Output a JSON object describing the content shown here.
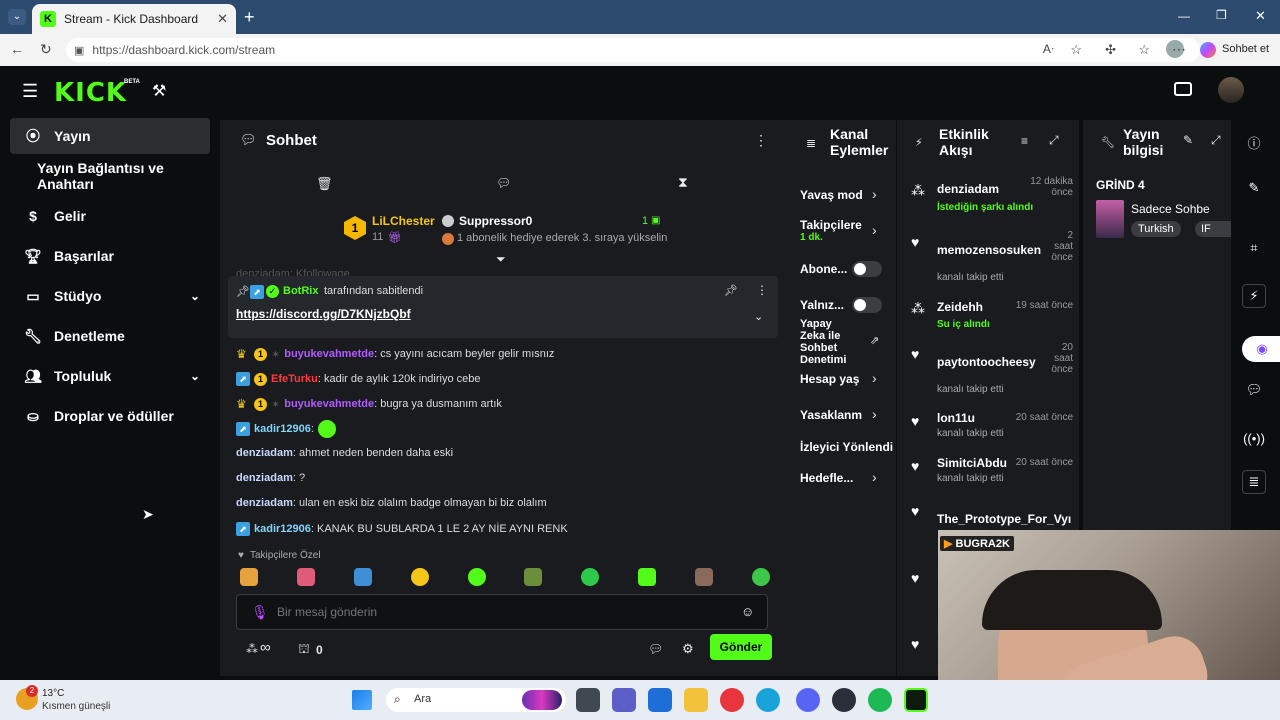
{
  "browser": {
    "tab_title": "Stream - Kick Dashboard",
    "url": "https://dashboard.kick.com/stream",
    "chat_btn": "Sohbet et"
  },
  "app": {
    "logo": "KICK",
    "beta": "BETA"
  },
  "sidebar": {
    "items": [
      {
        "label": "Yayın",
        "icon": "broadcast-icon"
      },
      {
        "label": "Yayın Bağlantısı ve Anahtarı",
        "icon": ""
      },
      {
        "label": "Gelir",
        "icon": "dollar-icon"
      },
      {
        "label": "Başarılar",
        "icon": "trophy-icon"
      },
      {
        "label": "Stüdyo",
        "icon": "studio-icon"
      },
      {
        "label": "Denetleme",
        "icon": "wrench-icon"
      },
      {
        "label": "Topluluk",
        "icon": "community-icon"
      },
      {
        "label": "Droplar ve ödüller",
        "icon": "drops-icon"
      }
    ]
  },
  "chat": {
    "title": "Sohbet",
    "gifter_top": {
      "name": "LiLChester",
      "count": "11",
      "rank": "1"
    },
    "gifter_second": {
      "name": "Suppressor0",
      "note": "1 abonelik hediye ederek 3. sıraya yükselin",
      "rank_count": "1"
    },
    "faded_line": "denziadam: Kfollowage",
    "pinned": {
      "by_name": "BotRix",
      "by_text": "tarafından sabitlendi",
      "link": "https://discord.gg/D7KNjzbQbf"
    },
    "messages": [
      {
        "user": "buyukevahmetde",
        "color": "#b15cff",
        "text": ": cs yayını acıcam beyler gelir mısnız"
      },
      {
        "user": "EfeTurku",
        "color": "#ff3b3b",
        "text": ": kadir de aylık 120k indiriyo cebe"
      },
      {
        "user": "buyukevahmetde",
        "color": "#b15cff",
        "text": ": bugra ya dusmanım artık"
      },
      {
        "user": "kadir12906",
        "color": "#7fd6ff",
        "text": ":"
      },
      {
        "user": "denziadam",
        "color": "#c7d9ff",
        "text": ": ahmet neden benden daha eski"
      },
      {
        "user": "denziadam",
        "color": "#c7d9ff",
        "text": ": ?"
      },
      {
        "user": "denziadam",
        "color": "#c7d9ff",
        "text": ": ulan en eski biz olalım badge olmayan bi biz olalım"
      },
      {
        "user": "kadir12906",
        "color": "#7fd6ff",
        "text": ": KANAK BU SUBLARDA 1 LE 2 AY NİE AYNI RENK"
      }
    ],
    "emote_label": "Takipçilere Özel",
    "input_placeholder": "Bir mesaj gönderin",
    "infinity": "∞",
    "chest_count": "0",
    "send": "Gönder"
  },
  "mod": {
    "title_1": "Kanal",
    "title_2": "Eylemler",
    "items": [
      "Yavaş mod",
      "Takipçilere",
      "1 dk.",
      "Abone...",
      "Yalnız...",
      "Yapay",
      "Zeka ile",
      "Sohbet",
      "Denetimi",
      "Hesap yaş",
      "Yasaklanm",
      "İzleyici Yönlendi",
      "Hedefle..."
    ]
  },
  "activity": {
    "title_1": "Etkinlik",
    "title_2": "Akışı",
    "events": [
      {
        "user": "denziadam",
        "sub": "İstediğin şarkı alındı",
        "time": "12 dakika önce"
      },
      {
        "user": "memozensosuken",
        "sub": "kanalı takip etti",
        "time": "2 saat önce"
      },
      {
        "user": "Zeidehh",
        "sub": "Su iç alındı",
        "time": "19 saat önce"
      },
      {
        "user": "paytontoocheesy",
        "sub": "kanalı takip etti",
        "time": "20 saat önce"
      },
      {
        "user": "lon11u",
        "sub": "kanalı takip etti",
        "time": "20 saat önce"
      },
      {
        "user": "SimitciAbdu",
        "sub": "kanalı takip etti",
        "time": "20 saat önce"
      },
      {
        "user": "The_Prototype_For_Vyı",
        "sub": "",
        "time": ""
      }
    ]
  },
  "info": {
    "title_1": "Yayın",
    "title_2": "bilgisi",
    "stream_title": "GRİND 4",
    "category": "Sadece Sohbe",
    "tag_1": "Turkish",
    "tag_2": "IF"
  },
  "webcam": {
    "name": "BUGRA2K"
  },
  "taskbar": {
    "temp": "13°C",
    "weather": "Kısmen güneşli",
    "search": "Ara",
    "notif": "2"
  }
}
